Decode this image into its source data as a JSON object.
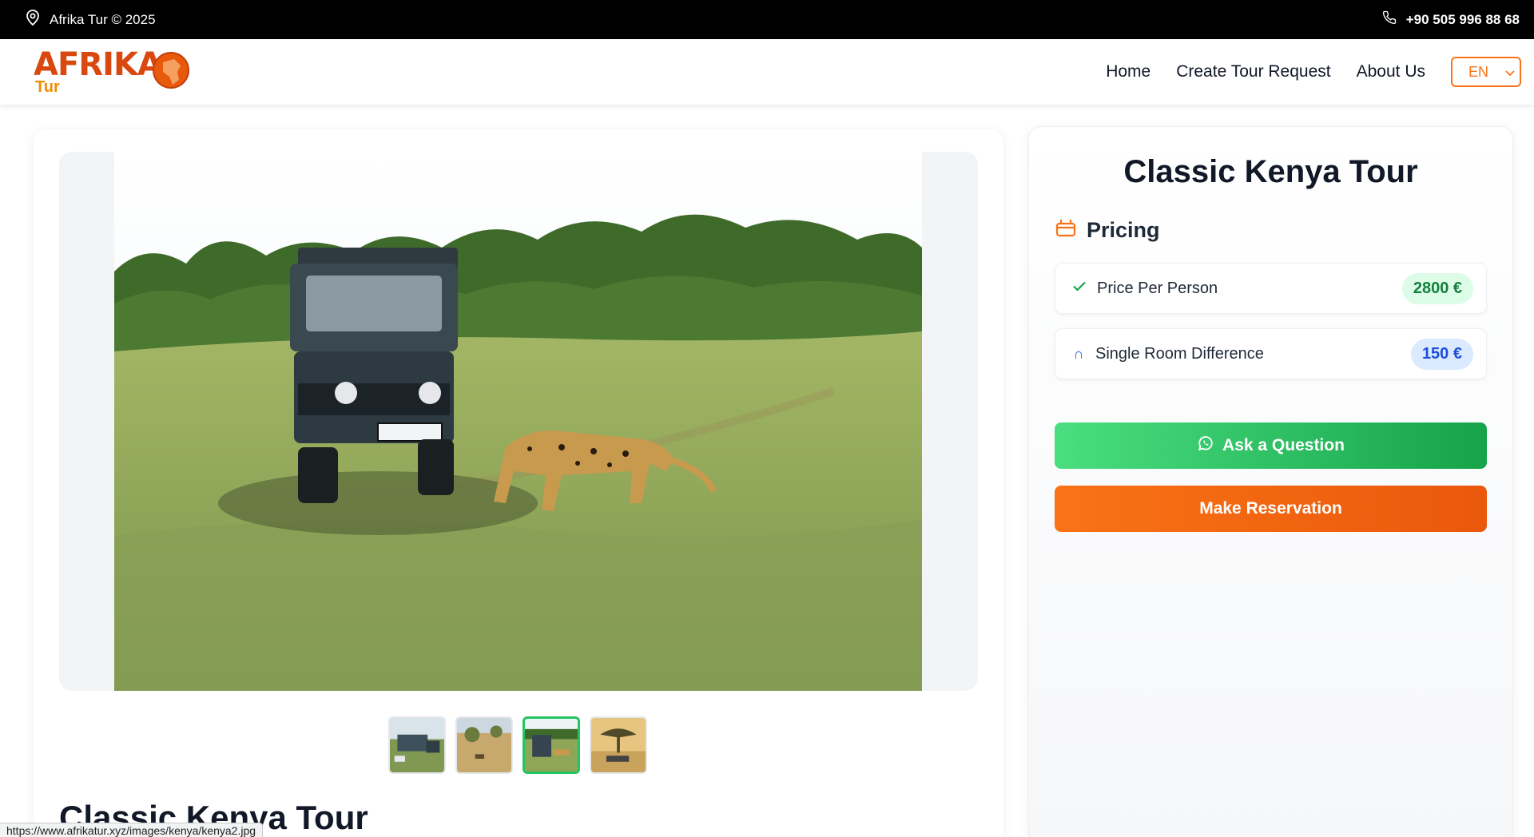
{
  "topbar": {
    "copyright": "Afrika Tur © 2025",
    "phone": "+90 505 996 88 68",
    "location_icon": "map-pin-icon",
    "phone_icon": "phone-icon"
  },
  "header": {
    "logo_text": "AFRIKA",
    "logo_sub": "Tur",
    "nav": [
      {
        "label": "Home"
      },
      {
        "label": "Create Tour Request"
      },
      {
        "label": "About Us"
      }
    ],
    "language": "EN"
  },
  "gallery": {
    "thumbnail_count": 4,
    "active_index": 2
  },
  "main": {
    "title": "Classic Kenya Tour"
  },
  "sidebar": {
    "title": "Classic Kenya Tour",
    "pricing_heading": "Pricing",
    "rows": [
      {
        "label": "Price Per Person",
        "value": "2800 €",
        "icon": "check-icon"
      },
      {
        "label": "Single Room Difference",
        "value": "150 €",
        "icon": "room-icon",
        "icon_glyph": "∩"
      }
    ],
    "ask_button": "Ask a Question",
    "reserve_button": "Make Reservation"
  },
  "status": {
    "url": "https://www.afrikatur.xyz/images/kenya/kenya2.jpg"
  },
  "colors": {
    "accent_orange": "#f97316",
    "accent_green": "#22c55e",
    "brand_logo": "#d9480f"
  }
}
